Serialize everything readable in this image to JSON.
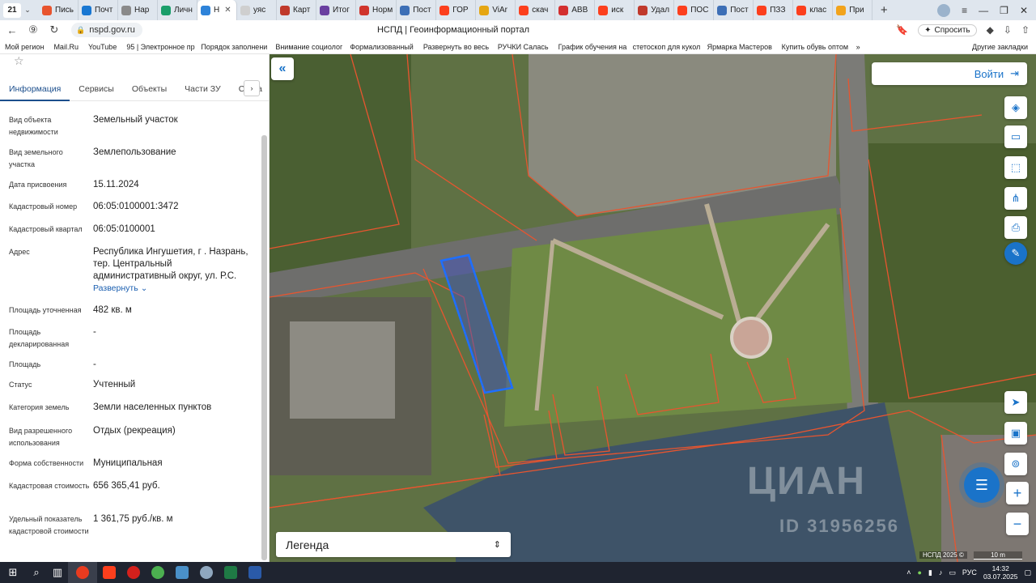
{
  "browser": {
    "tab_count": "21",
    "tabs": [
      {
        "label": "Пись",
        "color": "#e8542e"
      },
      {
        "label": "Почт",
        "color": "#1877d2"
      },
      {
        "label": "Нар",
        "color": "#8a8a8a"
      },
      {
        "label": "Личн",
        "color": "#1a9e6a"
      },
      {
        "label": "Н",
        "color": "#2e83d9",
        "active": true
      },
      {
        "label": "уяс",
        "color": "#cfcfcf"
      },
      {
        "label": "Карт",
        "color": "#c0392b"
      },
      {
        "label": "Итог",
        "color": "#6a3fa0"
      },
      {
        "label": "Норм",
        "color": "#d0342c"
      },
      {
        "label": "Пост",
        "color": "#3d6fb6"
      },
      {
        "label": "ГОР",
        "color": "#fc3f1d"
      },
      {
        "label": "ViAr",
        "color": "#e5a613"
      },
      {
        "label": "скач",
        "color": "#fc3f1d"
      },
      {
        "label": "АВВ",
        "color": "#d32f2f"
      },
      {
        "label": "иск",
        "color": "#fc3f1d"
      },
      {
        "label": "Удал",
        "color": "#c0392b"
      },
      {
        "label": "ПОС",
        "color": "#fc3f1d"
      },
      {
        "label": "Пост",
        "color": "#3d6fb6"
      },
      {
        "label": "ПЗЗ",
        "color": "#fc3f1d"
      },
      {
        "label": "клас",
        "color": "#fc3f1d"
      },
      {
        "label": "При",
        "color": "#f2a31b"
      }
    ],
    "url": "nspd.gov.ru",
    "page_title": "НСПД | Геоинформационный портал",
    "ask_label": "Спросить",
    "bookmarks": [
      "Мой регион",
      "Mail.Ru",
      "YouTube",
      "95 | Электронное пр",
      "Порядок заполнени",
      "Внимание социолог",
      "Формализованный",
      "Развернуть во весь",
      "РУЧКИ Салась",
      "График обучения на",
      "стетоскоп для кукол",
      "Ярмарка Мастеров",
      "Купить обувь оптом"
    ],
    "bookmarks_more": "»",
    "other_bookmarks": "Другие закладки"
  },
  "panel": {
    "tabs": [
      "Информация",
      "Сервисы",
      "Объекты",
      "Части ЗУ",
      "Соста"
    ],
    "properties": [
      {
        "label": "Вид объекта недвижимости",
        "value": "Земельный участок"
      },
      {
        "label": "Вид земельного участка",
        "value": "Землепользование"
      },
      {
        "label": "Дата присвоения",
        "value": "15.11.2024"
      },
      {
        "label": "Кадастровый номер",
        "value": "06:05:0100001:3472"
      },
      {
        "label": "Кадастровый квартал",
        "value": "06:05:0100001"
      },
      {
        "label": "Адрес",
        "value": "Республика Ингушетия, г . Назрань, тер. Центральный административный округ, ул. Р.С."
      },
      {
        "label": "Площадь уточненная",
        "value": "482 кв. м"
      },
      {
        "label": "Площадь декларированная",
        "value": "-"
      },
      {
        "label": "Площадь",
        "value": "-"
      },
      {
        "label": "Статус",
        "value": "Учтенный"
      },
      {
        "label": "Категория земель",
        "value": "Земли населенных пунктов"
      },
      {
        "label": "Вид разрешенного использования",
        "value": "Отдых (рекреация)"
      },
      {
        "label": "Форма собственности",
        "value": "Муниципальная"
      },
      {
        "label": "Кадастровая стоимость",
        "value": "656 365,41 руб."
      },
      {
        "label": "Удельный показатель кадастровой стоимости",
        "value": "1 361,75 руб./кв. м"
      }
    ],
    "expand_label": "Развернуть"
  },
  "map": {
    "login_label": "Войти",
    "legend_label": "Легенда",
    "copyright": "НСПД 2025 ©",
    "scale_label": "10 m",
    "watermark": "ЦИАН",
    "watermark_id": "ID 31956256",
    "parcel_color": "#1e6fff",
    "boundary_color": "#e8552f"
  },
  "taskbar": {
    "lang": "РУС",
    "time": "14:32",
    "date": "03.07.2025"
  }
}
